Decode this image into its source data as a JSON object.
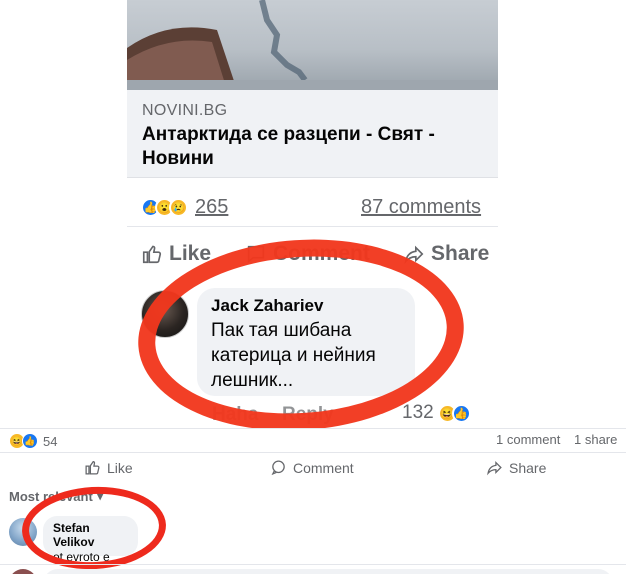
{
  "shared_post": {
    "link_domain": "NOVINI.BG",
    "link_title": "Антарктида се разцепи - Свят - Новини",
    "reaction_count": "265",
    "comments_count": "87 comments",
    "actions": {
      "like": "Like",
      "comment": "Comment",
      "share": "Share"
    },
    "comment": {
      "author": "Jack Zahariev",
      "text": "Пак тая шибана катерица и нейния лешник...",
      "sub_actions": {
        "like": "Haha",
        "reply": "Reply"
      },
      "reaction_count": "132"
    }
  },
  "post": {
    "reaction_count": "54",
    "comments_summary": "1 comment",
    "shares_summary": "1 share",
    "actions": {
      "like": "Like",
      "comment": "Comment",
      "share": "Share"
    },
    "sort_label": "Most relevant",
    "comment": {
      "author": "Stefan Velikov",
      "text": "ot evroto e"
    }
  },
  "colors": {
    "facebook_blue": "#1877f2",
    "annotation_red": "#f1371d",
    "secondary_text": "#65676b"
  }
}
